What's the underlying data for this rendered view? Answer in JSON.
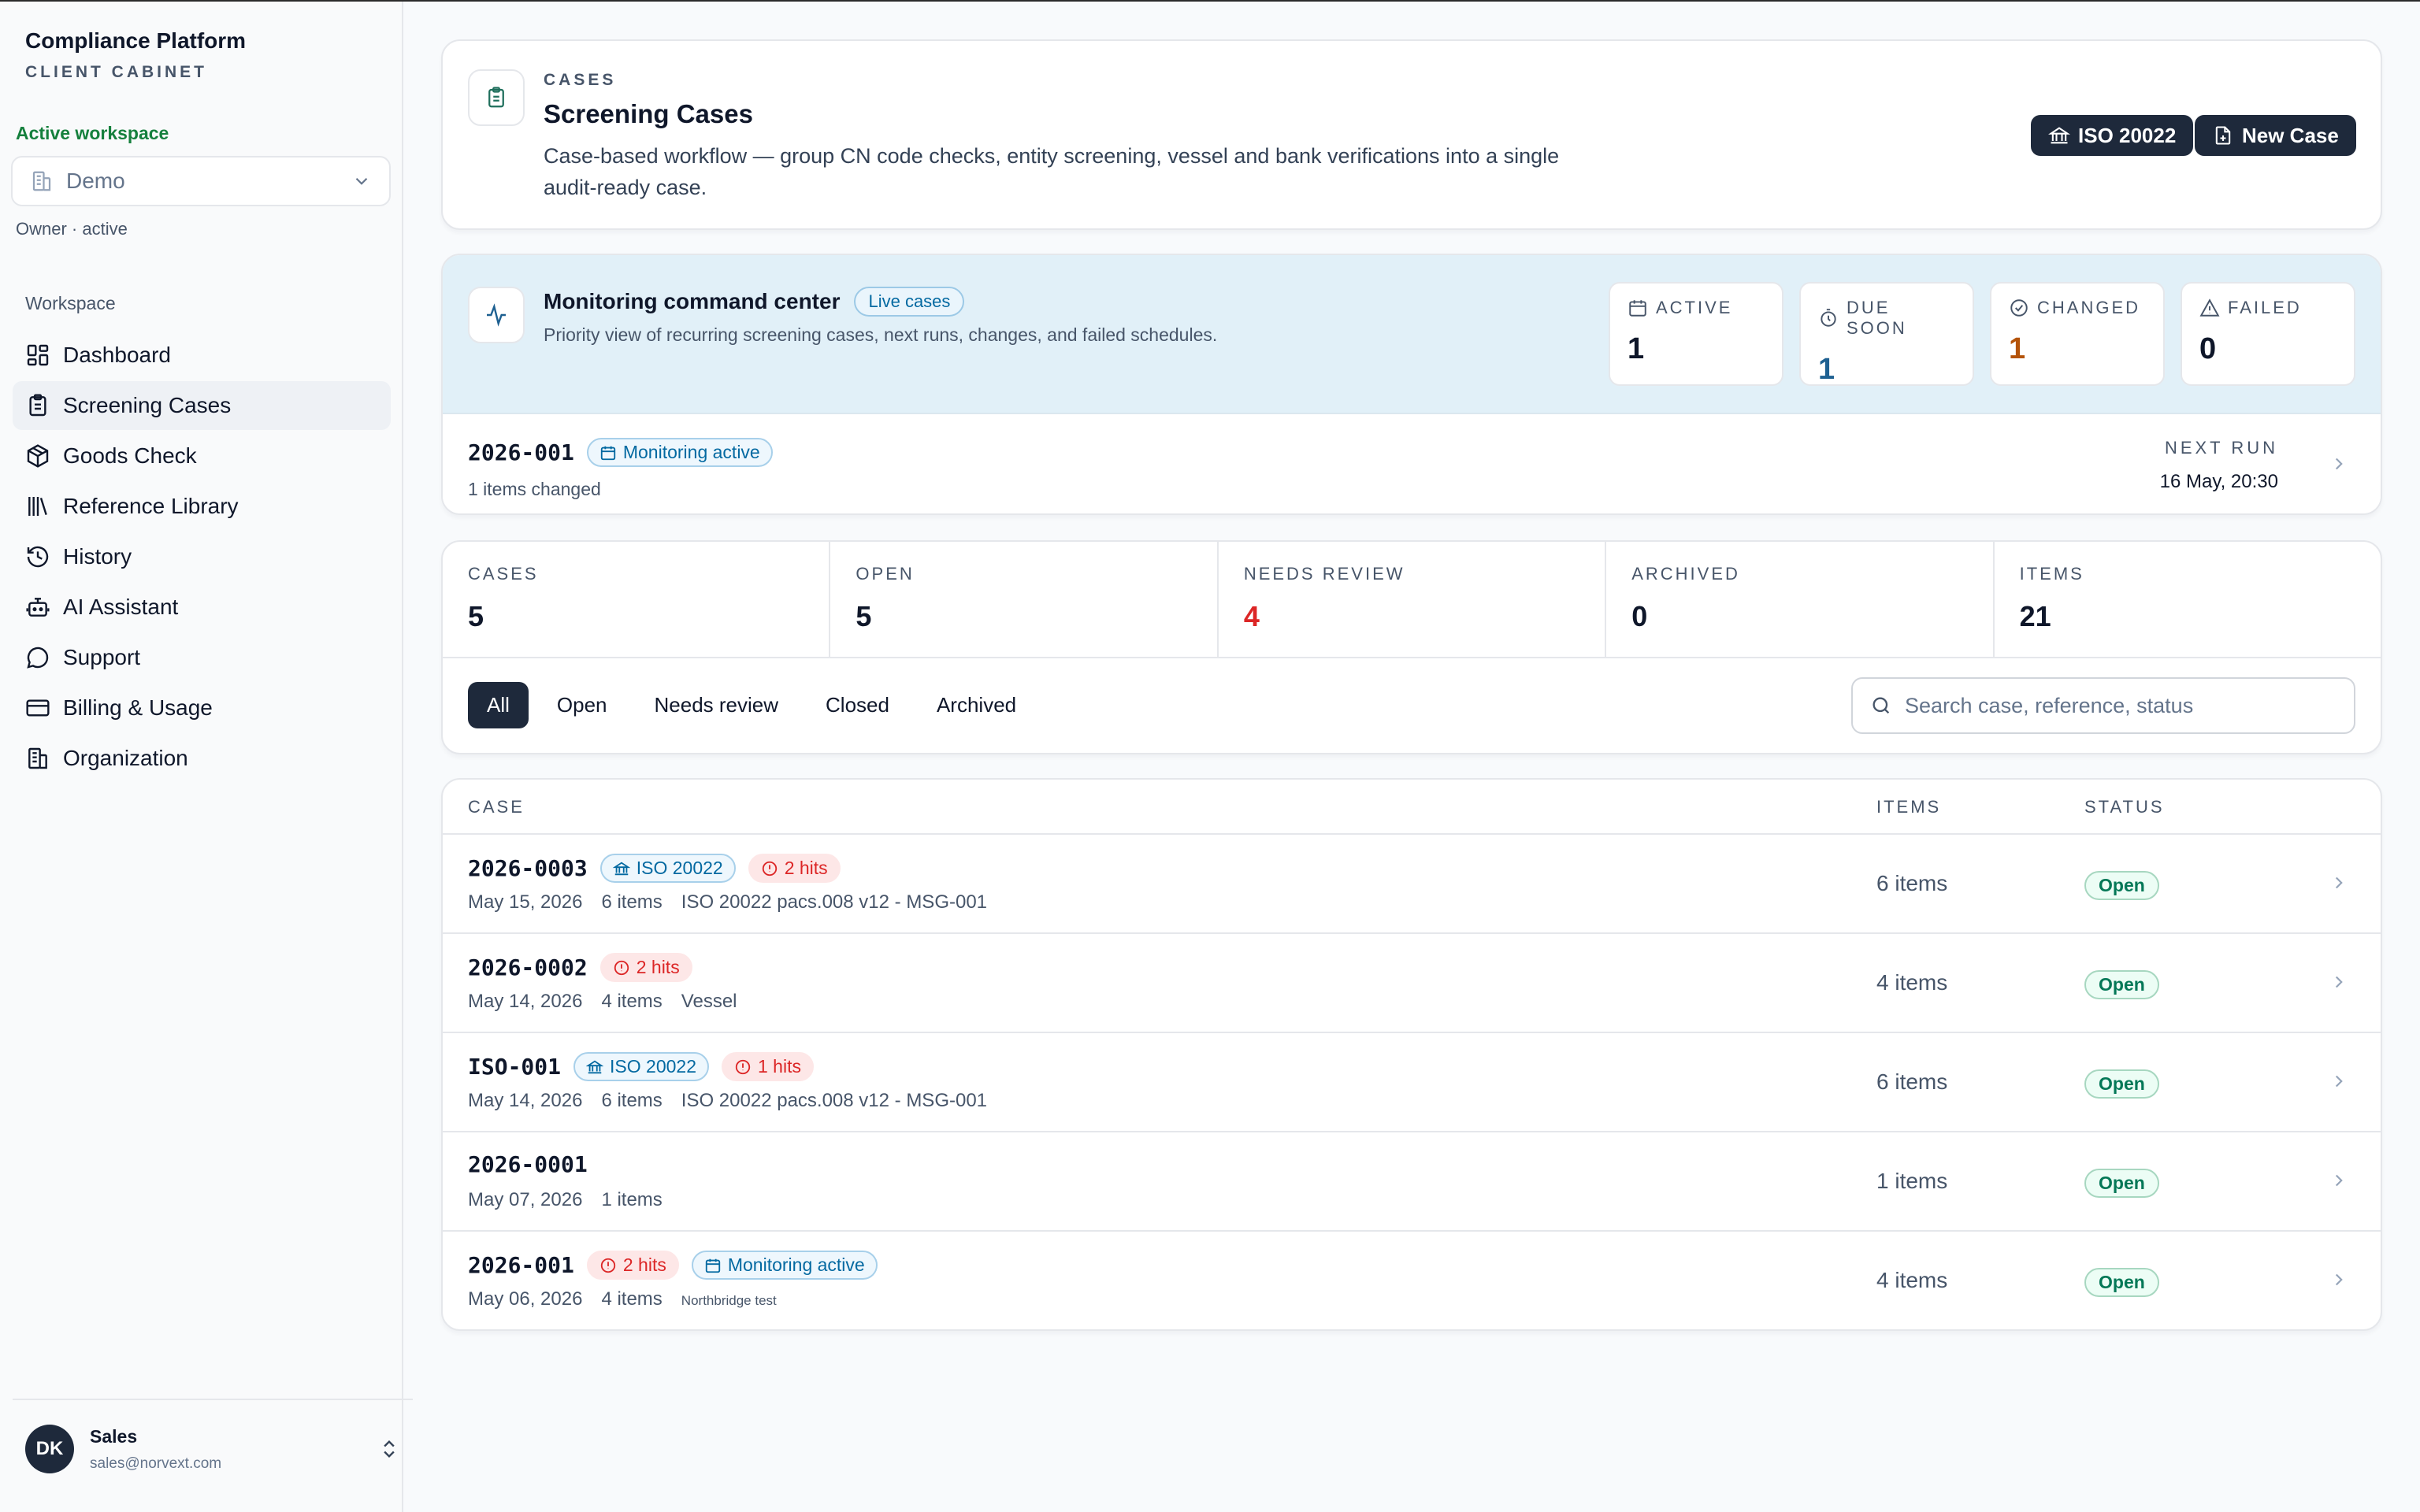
{
  "sidebar": {
    "brand_title": "Compliance Platform",
    "brand_sub": "CLIENT CABINET",
    "workspace_label": "Active workspace",
    "workspace_name": "Demo",
    "workspace_status": "Owner · active",
    "section_label": "Workspace",
    "items": [
      {
        "label": "Dashboard",
        "icon": "dashboard-icon"
      },
      {
        "label": "Screening Cases",
        "icon": "clipboard-icon"
      },
      {
        "label": "Goods Check",
        "icon": "package-icon"
      },
      {
        "label": "Reference Library",
        "icon": "library-icon"
      },
      {
        "label": "History",
        "icon": "history-icon"
      },
      {
        "label": "AI Assistant",
        "icon": "bot-icon"
      },
      {
        "label": "Support",
        "icon": "chat-icon"
      },
      {
        "label": "Billing & Usage",
        "icon": "card-icon"
      },
      {
        "label": "Organization",
        "icon": "building-icon"
      }
    ],
    "active_item": "Screening Cases",
    "user": {
      "initials": "DK",
      "name": "Sales",
      "email": "sales@norvext.com"
    }
  },
  "header": {
    "eyebrow": "CASES",
    "title": "Screening Cases",
    "description": "Case-based workflow — group CN code checks, entity screening, vessel and bank verifications into a single audit-ready case.",
    "iso_button": "ISO 20022",
    "new_case_button": "New Case"
  },
  "monitor": {
    "title": "Monitoring command center",
    "badge": "Live cases",
    "description": "Priority view of recurring screening cases, next runs, changes, and failed schedules.",
    "stats": [
      {
        "label": "ACTIVE",
        "value": "1",
        "color": "#0f172a",
        "icon": "calendar-icon"
      },
      {
        "label": "DUE SOON",
        "value": "1",
        "color": "#1e6091",
        "icon": "timer-icon"
      },
      {
        "label": "CHANGED",
        "value": "1",
        "color": "#b45309",
        "icon": "check-circle-icon"
      },
      {
        "label": "FAILED",
        "value": "0",
        "color": "#0f172a",
        "icon": "warning-icon"
      }
    ],
    "row": {
      "case": "2026-001",
      "badge": "Monitoring active",
      "sub": "1 items changed",
      "next_run_label": "NEXT RUN",
      "next_run_value": "16 May, 20:30"
    }
  },
  "summary": [
    {
      "label": "CASES",
      "value": "5",
      "color": "#0f172a"
    },
    {
      "label": "OPEN",
      "value": "5",
      "color": "#0f172a"
    },
    {
      "label": "NEEDS REVIEW",
      "value": "4",
      "color": "#dc2626"
    },
    {
      "label": "ARCHIVED",
      "value": "0",
      "color": "#0f172a"
    },
    {
      "label": "ITEMS",
      "value": "21",
      "color": "#0f172a"
    }
  ],
  "filters": [
    "All",
    "Open",
    "Needs review",
    "Closed",
    "Archived"
  ],
  "search": {
    "placeholder": "Search case, reference, status"
  },
  "table": {
    "headers": {
      "case": "CASE",
      "items": "ITEMS",
      "status": "STATUS"
    },
    "rows": [
      {
        "case": "2026-0003",
        "iso": "ISO 20022",
        "hits": "2 hits",
        "monitoring": "",
        "date": "May 15, 2026",
        "count": "6 items",
        "ref": "ISO 20022 pacs.008 v12 - MSG-001",
        "ref_small": false,
        "items": "6 items",
        "status": "Open"
      },
      {
        "case": "2026-0002",
        "iso": "",
        "hits": "2 hits",
        "monitoring": "",
        "date": "May 14, 2026",
        "count": "4 items",
        "ref": "Vessel",
        "ref_small": false,
        "items": "4 items",
        "status": "Open"
      },
      {
        "case": "ISO-001",
        "iso": "ISO 20022",
        "hits": "1 hits",
        "monitoring": "",
        "date": "May 14, 2026",
        "count": "6 items",
        "ref": "ISO 20022 pacs.008 v12 - MSG-001",
        "ref_small": false,
        "items": "6 items",
        "status": "Open"
      },
      {
        "case": "2026-0001",
        "iso": "",
        "hits": "",
        "monitoring": "",
        "date": "May 07, 2026",
        "count": "1 items",
        "ref": "",
        "ref_small": false,
        "items": "1 items",
        "status": "Open"
      },
      {
        "case": "2026-001",
        "iso": "",
        "hits": "2 hits",
        "monitoring": "Monitoring active",
        "date": "May 06, 2026",
        "count": "4 items",
        "ref": "Northbridge test",
        "ref_small": true,
        "items": "4 items",
        "status": "Open"
      }
    ]
  }
}
